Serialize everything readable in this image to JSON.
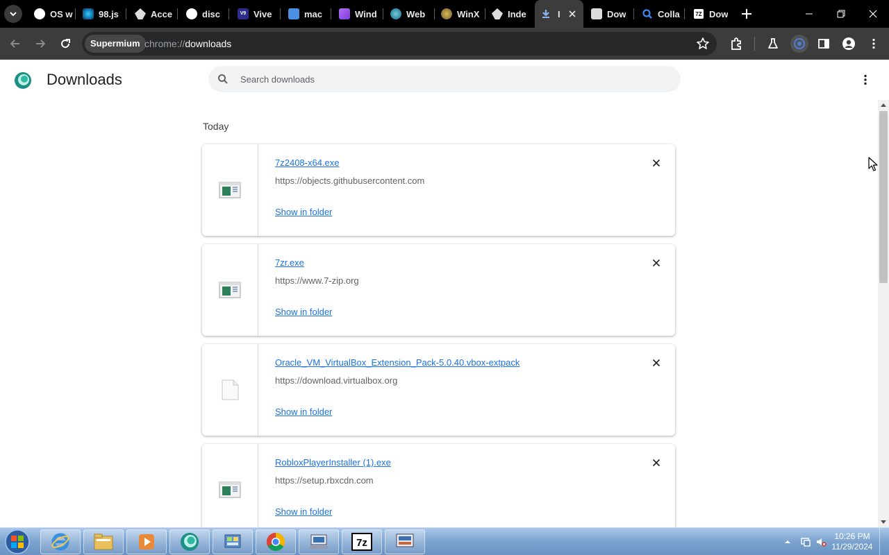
{
  "browser": {
    "tabs": [
      {
        "label": "OS w",
        "icon": "github-icon"
      },
      {
        "label": "98.js",
        "icon": "98js-icon"
      },
      {
        "label": "Acce",
        "icon": "inkscape-icon"
      },
      {
        "label": "disc",
        "icon": "github-icon"
      },
      {
        "label": "Vive",
        "icon": "vivetool-icon"
      },
      {
        "label": "mac",
        "icon": "mac-icon"
      },
      {
        "label": "Wind",
        "icon": "windows-icon"
      },
      {
        "label": "Web",
        "icon": "globe-icon"
      },
      {
        "label": "WinX",
        "icon": "winxp-icon"
      },
      {
        "label": "Inde",
        "icon": "inkscape-icon"
      },
      {
        "label": "I",
        "icon": "download-icon",
        "active": true
      },
      {
        "label": "Dow",
        "icon": "download-page-icon"
      },
      {
        "label": "Colla",
        "icon": "search-icon"
      },
      {
        "label": "Dow",
        "icon": "7zip-icon"
      }
    ],
    "chip_label": "Supermium",
    "url_scheme": "chrome://",
    "url_path": "downloads"
  },
  "page": {
    "title": "Downloads",
    "search_placeholder": "Search downloads",
    "section_label": "Today",
    "downloads": [
      {
        "filename": "7z2408-x64.exe",
        "source": "https://objects.githubusercontent.com",
        "action": "Show in folder",
        "icon": "exe-icon"
      },
      {
        "filename": "7zr.exe",
        "source": "https://www.7-zip.org",
        "action": "Show in folder",
        "icon": "exe-icon"
      },
      {
        "filename": "Oracle_VM_VirtualBox_Extension_Pack-5.0.40.vbox-extpack",
        "source": "https://download.virtualbox.org",
        "action": "Show in folder",
        "icon": "blank-file-icon"
      },
      {
        "filename": "RobloxPlayerInstaller (1).exe",
        "source": "https://setup.rbxcdn.com",
        "action": "Show in folder",
        "icon": "exe-icon"
      }
    ]
  },
  "taskbar": {
    "apps": [
      "internet-explorer-icon",
      "file-explorer-icon",
      "media-player-icon",
      "supermium-icon",
      "control-panel-icon",
      "chrome-icon",
      "network-icon",
      "7zip-icon",
      "screen-icon"
    ],
    "time": "10:26 PM",
    "date": "11/29/2024"
  },
  "colors": {
    "accent": "#1a73e8",
    "tabstrip": "#000000",
    "toolbar": "#3c3c3c",
    "taskbar": "#7ba3cf"
  }
}
